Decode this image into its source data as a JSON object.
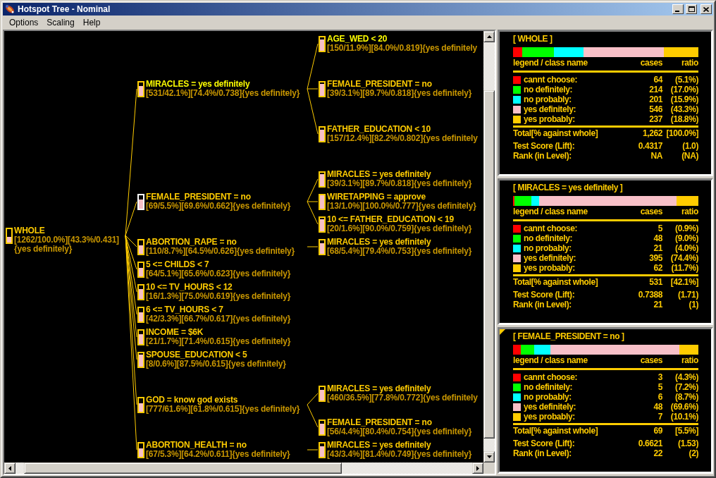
{
  "window": {
    "title": "Hotspot Tree - Nominal"
  },
  "menu": [
    "Options",
    "Scaling",
    "Help"
  ],
  "tree": {
    "root": {
      "title": "WHOLE",
      "stats": "[1262/100.0%][43.3%/0.431]",
      "prediction": "{yes definitely}",
      "level": 0.433,
      "selected": false,
      "highlighted": false,
      "children": [
        {
          "title": "MIRACLES = yes definitely",
          "stats": "[531/42.1%][74.4%/0.738]",
          "prediction": "{yes definitely}",
          "level": 0.744,
          "selected": false,
          "highlighted": true,
          "children": [
            {
              "title": "AGE_WED < 20",
              "stats": "[150/11.9%][84.0%/0.819]",
              "prediction": "{yes definitely",
              "level": 0.84,
              "selected": false,
              "highlighted": true
            },
            {
              "title": "FEMALE_PRESIDENT = no",
              "stats": "[39/3.1%][89.7%/0.818]",
              "prediction": "{yes definitely}",
              "level": 0.897,
              "selected": false,
              "highlighted": false
            },
            {
              "title": "FATHER_EDUCATION < 10",
              "stats": "[157/12.4%][82.2%/0.802]",
              "prediction": "{yes definitely",
              "level": 0.822,
              "selected": false,
              "highlighted": false
            }
          ]
        },
        {
          "title": "FEMALE_PRESIDENT = no",
          "stats": "[69/5.5%][69.6%/0.662]",
          "prediction": "{yes definitely}",
          "level": 0.696,
          "selected": true,
          "highlighted": false,
          "children": [
            {
              "title": "MIRACLES = yes definitely",
              "stats": "[39/3.1%][89.7%/0.818]",
              "prediction": "{yes definitely}",
              "level": 0.897,
              "selected": false,
              "highlighted": false
            },
            {
              "title": "WIRETAPPING = approve",
              "stats": "[13/1.0%][100.0%/0.777]",
              "prediction": "{yes definitely}",
              "level": 1.0,
              "selected": false,
              "highlighted": false
            },
            {
              "title": "10 <= FATHER_EDUCATION < 19",
              "stats": "[20/1.6%][90.0%/0.759]",
              "prediction": "{yes definitely}",
              "level": 0.9,
              "selected": false,
              "highlighted": false
            }
          ]
        },
        {
          "title": "ABORTION_RAPE = no",
          "stats": "[110/8.7%][64.5%/0.626]",
          "prediction": "{yes definitely}",
          "level": 0.645,
          "selected": false,
          "highlighted": false,
          "children": [
            {
              "title": "MIRACLES = yes definitely",
              "stats": "[68/5.4%][79.4%/0.753]",
              "prediction": "{yes definitely}",
              "level": 0.794,
              "selected": false,
              "highlighted": false
            }
          ]
        },
        {
          "title": "5 <= CHILDS < 7",
          "stats": "[64/5.1%][65.6%/0.623]",
          "prediction": "{yes definitely}",
          "level": 0.656,
          "selected": false,
          "highlighted": false
        },
        {
          "title": "10 <= TV_HOURS < 12",
          "stats": "[16/1.3%][75.0%/0.619]",
          "prediction": "{yes definitely}",
          "level": 0.75,
          "selected": false,
          "highlighted": false
        },
        {
          "title": "6 <= TV_HOURS < 7",
          "stats": "[42/3.3%][66.7%/0.617]",
          "prediction": "{yes definitely}",
          "level": 0.667,
          "selected": false,
          "highlighted": false
        },
        {
          "title": "INCOME = $6K",
          "stats": "[21/1.7%][71.4%/0.615]",
          "prediction": "{yes definitely}",
          "level": 0.714,
          "selected": false,
          "highlighted": false
        },
        {
          "title": "SPOUSE_EDUCATION < 5",
          "stats": "[8/0.6%][87.5%/0.615]",
          "prediction": "{yes definitely}",
          "level": 0.875,
          "selected": false,
          "highlighted": false
        },
        {
          "title": "GOD = know god exists",
          "stats": "[777/61.6%][61.8%/0.615]",
          "prediction": "{yes definitely}",
          "level": 0.618,
          "selected": false,
          "highlighted": false,
          "children": [
            {
              "title": "MIRACLES = yes definitely",
              "stats": "[460/36.5%][77.8%/0.772]",
              "prediction": "{yes definitely",
              "level": 0.778,
              "selected": false,
              "highlighted": false
            },
            {
              "title": "FEMALE_PRESIDENT = no",
              "stats": "[56/4.4%][80.4%/0.754]",
              "prediction": "{yes definitely}",
              "level": 0.804,
              "selected": false,
              "highlighted": false
            }
          ]
        },
        {
          "title": "ABORTION_HEALTH = no",
          "stats": "[67/5.3%][64.2%/0.611]",
          "prediction": "{yes definitely}",
          "level": 0.642,
          "selected": false,
          "highlighted": false,
          "children": [
            {
              "title": "MIRACLES = yes definitely",
              "stats": "[43/3.4%][81.4%/0.749]",
              "prediction": "{yes definitely}",
              "level": 0.814,
              "selected": false,
              "highlighted": false
            }
          ]
        }
      ]
    }
  },
  "info_panels": [
    {
      "title": "[ WHOLE ]",
      "marked": false,
      "header": {
        "name": "legend / class name",
        "cases": "cases",
        "ratio": "ratio"
      },
      "classes": [
        {
          "name": "cannt choose:",
          "cases": "64",
          "ratio": "(5.1%)",
          "color": "#ff0000"
        },
        {
          "name": "no definitely:",
          "cases": "214",
          "ratio": "(17.0%)",
          "color": "#00ff00"
        },
        {
          "name": "no probably:",
          "cases": "201",
          "ratio": "(15.9%)",
          "color": "#00ffff"
        },
        {
          "name": "yes definitely:",
          "cases": "546",
          "ratio": "(43.3%)",
          "color": "#f8c0c8"
        },
        {
          "name": "yes probably:",
          "cases": "237",
          "ratio": "(18.8%)",
          "color": "#ffcc00"
        }
      ],
      "total": {
        "label": "Total[% against whole]",
        "value": "1,262",
        "ratio": "[100.0%]"
      },
      "metrics": [
        {
          "label": "Test Score (Lift):",
          "value": "0.4317",
          "ratio": "(1.0)"
        },
        {
          "label": "Rank (in Level):",
          "value": "NA",
          "ratio": "(NA)"
        }
      ]
    },
    {
      "title": "[ MIRACLES = yes definitely ]",
      "marked": false,
      "header": {
        "name": "legend / class name",
        "cases": "cases",
        "ratio": "ratio"
      },
      "classes": [
        {
          "name": "cannt choose:",
          "cases": "5",
          "ratio": "(0.9%)",
          "color": "#ff0000"
        },
        {
          "name": "no definitely:",
          "cases": "48",
          "ratio": "(9.0%)",
          "color": "#00ff00"
        },
        {
          "name": "no probably:",
          "cases": "21",
          "ratio": "(4.0%)",
          "color": "#00ffff"
        },
        {
          "name": "yes definitely:",
          "cases": "395",
          "ratio": "(74.4%)",
          "color": "#f8c0c8"
        },
        {
          "name": "yes probably:",
          "cases": "62",
          "ratio": "(11.7%)",
          "color": "#ffcc00"
        }
      ],
      "total": {
        "label": "Total[% against whole]",
        "value": "531",
        "ratio": "[42.1%]"
      },
      "metrics": [
        {
          "label": "Test Score (Lift):",
          "value": "0.7388",
          "ratio": "(1.71)"
        },
        {
          "label": "Rank (in Level):",
          "value": "21",
          "ratio": "(1)"
        }
      ]
    },
    {
      "title": "[ FEMALE_PRESIDENT = no ]",
      "marked": true,
      "header": {
        "name": "legend / class name",
        "cases": "cases",
        "ratio": "ratio"
      },
      "classes": [
        {
          "name": "cannt choose:",
          "cases": "3",
          "ratio": "(4.3%)",
          "color": "#ff0000"
        },
        {
          "name": "no definitely:",
          "cases": "5",
          "ratio": "(7.2%)",
          "color": "#00ff00"
        },
        {
          "name": "no probably:",
          "cases": "6",
          "ratio": "(8.7%)",
          "color": "#00ffff"
        },
        {
          "name": "yes definitely:",
          "cases": "48",
          "ratio": "(69.6%)",
          "color": "#f8c0c8"
        },
        {
          "name": "yes probably:",
          "cases": "7",
          "ratio": "(10.1%)",
          "color": "#ffcc00"
        }
      ],
      "total": {
        "label": "Total[% against whole]",
        "value": "69",
        "ratio": "[5.5%]"
      },
      "metrics": [
        {
          "label": "Test Score (Lift):",
          "value": "0.6621",
          "ratio": "(1.53)"
        },
        {
          "label": "Rank (in Level):",
          "value": "22",
          "ratio": "(2)"
        }
      ]
    }
  ]
}
